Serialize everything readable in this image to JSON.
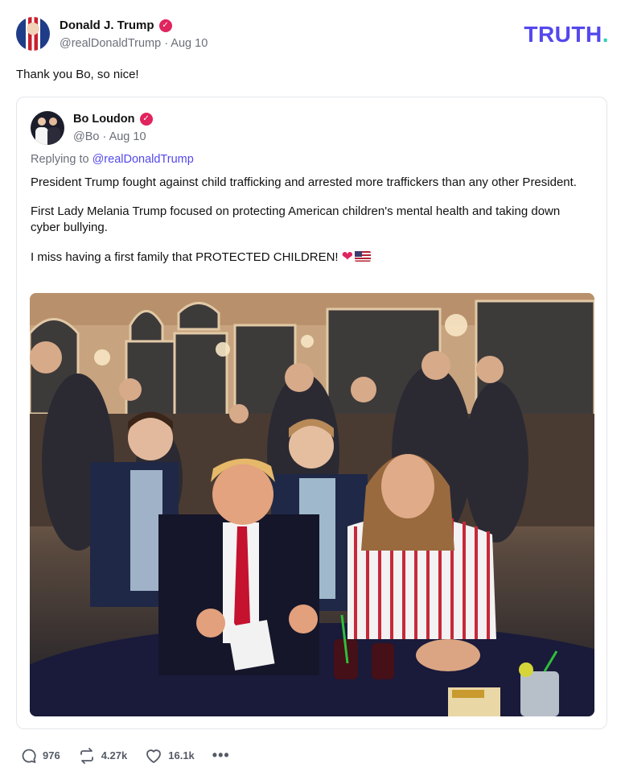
{
  "author": {
    "name": "Donald J. Trump",
    "handle": "@realDonaldTrump",
    "date": "Aug 10",
    "verified_icon": "check"
  },
  "brand": {
    "logo_text": "TRUTH",
    "logo_dot": ".",
    "accent_color": "#5448ee",
    "dot_color": "#2fd0b5"
  },
  "post": {
    "text": "Thank you Bo, so nice!"
  },
  "quoted": {
    "name": "Bo Loudon",
    "handle": "@Bo",
    "date": "Aug 10",
    "replying_prefix": "Replying to",
    "replying_to": "@realDonaldTrump",
    "paragraphs": [
      "President Trump fought against child trafficking and arrested more traffickers than any other President.",
      "First Lady Melania Trump focused on protecting American children's mental health and taking down cyber bullying.",
      "I miss having a first family that PROTECTED CHILDREN!"
    ],
    "emojis": [
      "red-heart",
      "us-flag"
    ]
  },
  "actions": {
    "replies": "976",
    "retruths": "4.27k",
    "likes": "16.1k",
    "more": "•••"
  }
}
